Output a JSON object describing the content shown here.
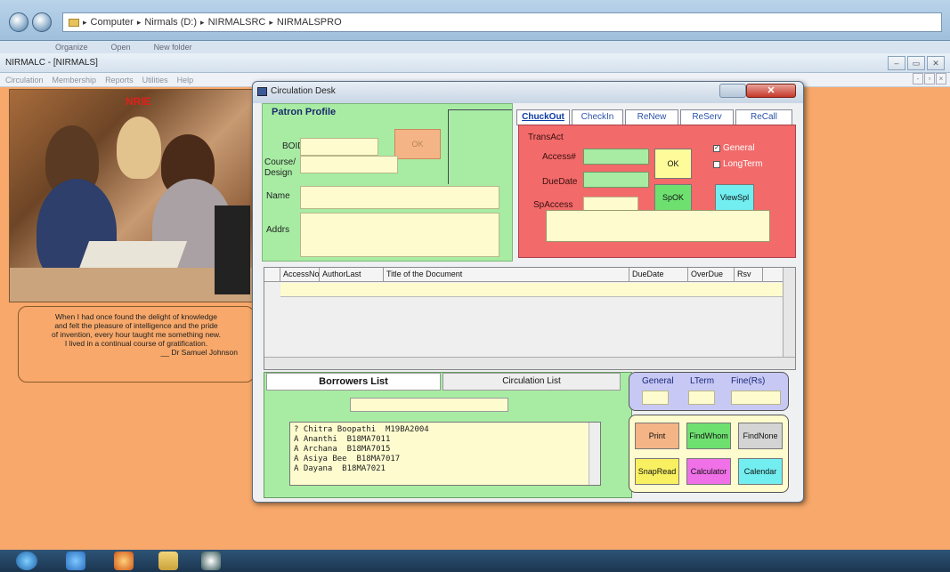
{
  "explorer": {
    "breadcrumbs": [
      "Computer",
      "Nirmals (D:)",
      "NIRMALSRC",
      "NIRMALSPRO"
    ],
    "menu": [
      "Organize",
      "Open",
      "New folder"
    ]
  },
  "app": {
    "title": "NIRMALC - [NIRMALS]",
    "menu": [
      "Circulation",
      "Membership",
      "Reports",
      "Utilities",
      "Help"
    ],
    "win_buttons": [
      "‒",
      "▭",
      "✕"
    ],
    "mdi_buttons": [
      "-",
      "▫",
      "×"
    ]
  },
  "photo": {
    "logo": "NRIE"
  },
  "quote": {
    "lines": [
      "When I had once found the delight of knowledge",
      "and felt the pleasure of intelligence and the pride",
      "of invention, every hour taught me something new.",
      "I lived in a continual course of gratification."
    ],
    "author": "__ Dr Samuel Johnson"
  },
  "dialog": {
    "title": "Circulation Desk",
    "close": "✕",
    "patron": {
      "heading": "Patron Profile",
      "labels": {
        "boid": "BOID",
        "course": "Course/",
        "design": "Design",
        "name": "Name",
        "addrs": "Addrs"
      },
      "ok": "OK"
    },
    "tabs": [
      "ChuckOut",
      "CheckIn",
      "ReNew",
      "ReServ",
      "ReCall"
    ],
    "transact": {
      "label": "TransAct",
      "access": "Access#",
      "duedate": "DueDate",
      "spaccess": "SpAccess",
      "ok": "OK",
      "spok": "SpOK",
      "viewsp": "ViewSpl",
      "general": "General",
      "longterm": "LongTerm"
    },
    "grid": {
      "columns": [
        "AccessNo",
        "AuthorLast",
        "Title of the Document",
        "DueDate",
        "OverDue",
        "Rsv"
      ]
    },
    "borrowers": {
      "tab_borrowers": "Borrowers List",
      "tab_circulation": "Circulation List",
      "items": [
        "? Chitra Boopathi  M19BA2004",
        "A Ananthi  B18MA7011",
        "A Archana  B18MA7015",
        "A Asiya Bee  B18MA7017",
        "A Dayana  B18MA7021"
      ]
    },
    "fine": {
      "general": "General",
      "lterm": "LTerm",
      "fine": "Fine(Rs)"
    },
    "actions": {
      "print": "Print",
      "findwhom": "FindWhom",
      "findnone": "FindNone",
      "snapread": "SnapRead",
      "calculator": "Calculator",
      "calendar": "Calendar"
    }
  },
  "colors": {
    "desktop": "#f7a86a",
    "patron_bg": "#a8eca4",
    "transact_bg": "#f26a6a",
    "field_bg": "#fefccf",
    "tab_text": "#2a52a8"
  }
}
